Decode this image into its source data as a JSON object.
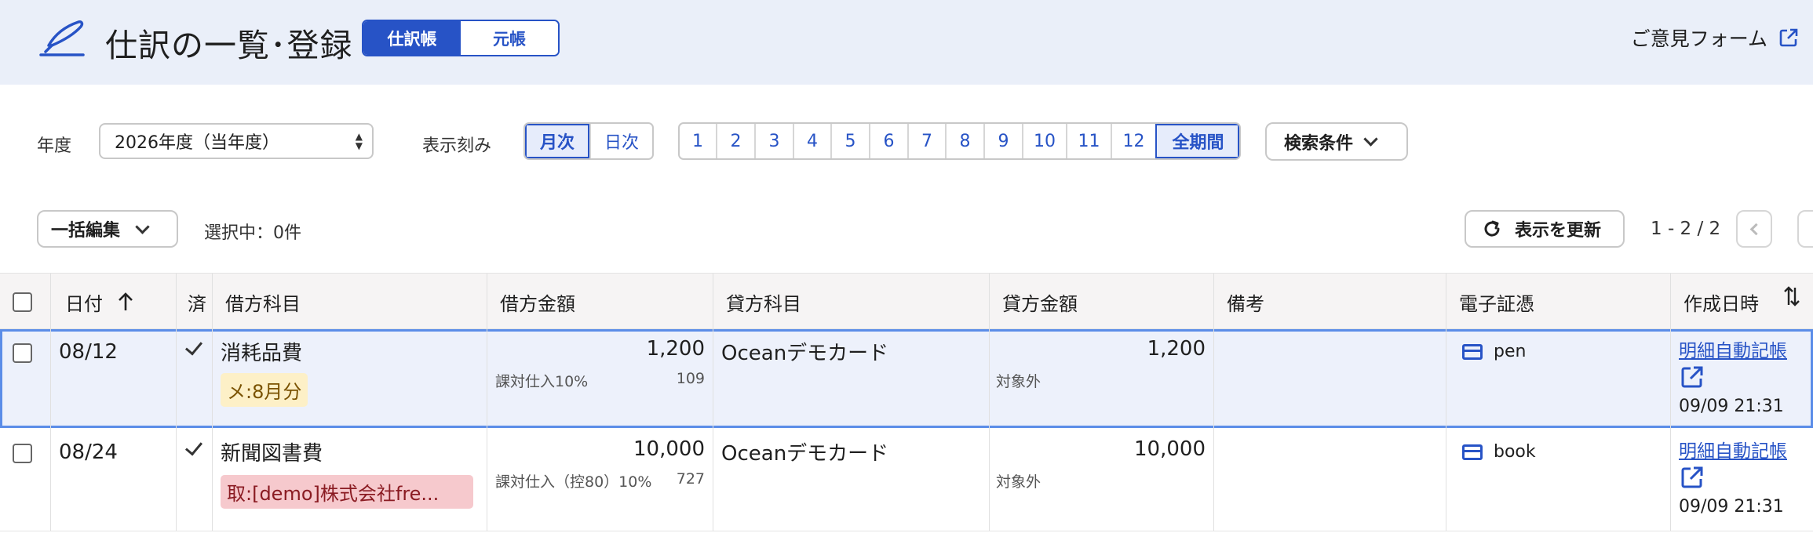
{
  "header": {
    "title": "仕訳の一覧･登録",
    "view_toggle": [
      "仕訳帳",
      "元帳"
    ],
    "feedback_label": "ご意見フォーム",
    "logo_icon": "quill-pen-icon",
    "accent_color": "#2753c6",
    "header_bg": "#eaeff9"
  },
  "filters": {
    "year_label": "年度",
    "year_value": "2026年度（当年度）",
    "interval_label": "表示刻み",
    "interval_options": [
      "月次",
      "日次"
    ],
    "interval_selected": "月次",
    "months": [
      "1",
      "2",
      "3",
      "4",
      "5",
      "6",
      "7",
      "8",
      "9",
      "10",
      "11",
      "12"
    ],
    "all_period_label": "全期間",
    "search_conditions_label": "検索条件"
  },
  "actions": {
    "bulk_edit_label": "一括編集",
    "selected_count": "選択中：0件",
    "refresh_label": "表示を更新",
    "pagination": "1 - 2 / 2"
  },
  "table": {
    "columns": [
      "日付",
      "済",
      "借方科目",
      "借方金額",
      "貸方科目",
      "貸方金額",
      "備考",
      "電子証憑",
      "作成日時"
    ],
    "rows": [
      {
        "date": "08/12",
        "done": true,
        "debit_account": "消耗品費",
        "tag": "メ:8月分",
        "tag_type": "memo",
        "debit_amount": "1,200",
        "debit_tax": "課対仕入10%",
        "debit_tax_amount": "109",
        "credit_account": "Oceanデモカード",
        "credit_amount": "1,200",
        "credit_tax": "対象外",
        "note": "",
        "receipt": "pen",
        "created_link": "明細自動記帳",
        "created_at": "09/09 21:31",
        "selected": true
      },
      {
        "date": "08/24",
        "done": true,
        "debit_account": "新聞図書費",
        "tag": "取:[demo]株式会社fre...",
        "tag_type": "partner",
        "debit_amount": "10,000",
        "debit_tax": "課対仕入（控80）10%",
        "debit_tax_amount": "727",
        "credit_account": "Oceanデモカード",
        "credit_amount": "10,000",
        "credit_tax": "対象外",
        "note": "",
        "receipt": "book",
        "created_link": "明細自動記帳",
        "created_at": "09/09 21:31",
        "selected": false
      }
    ]
  }
}
